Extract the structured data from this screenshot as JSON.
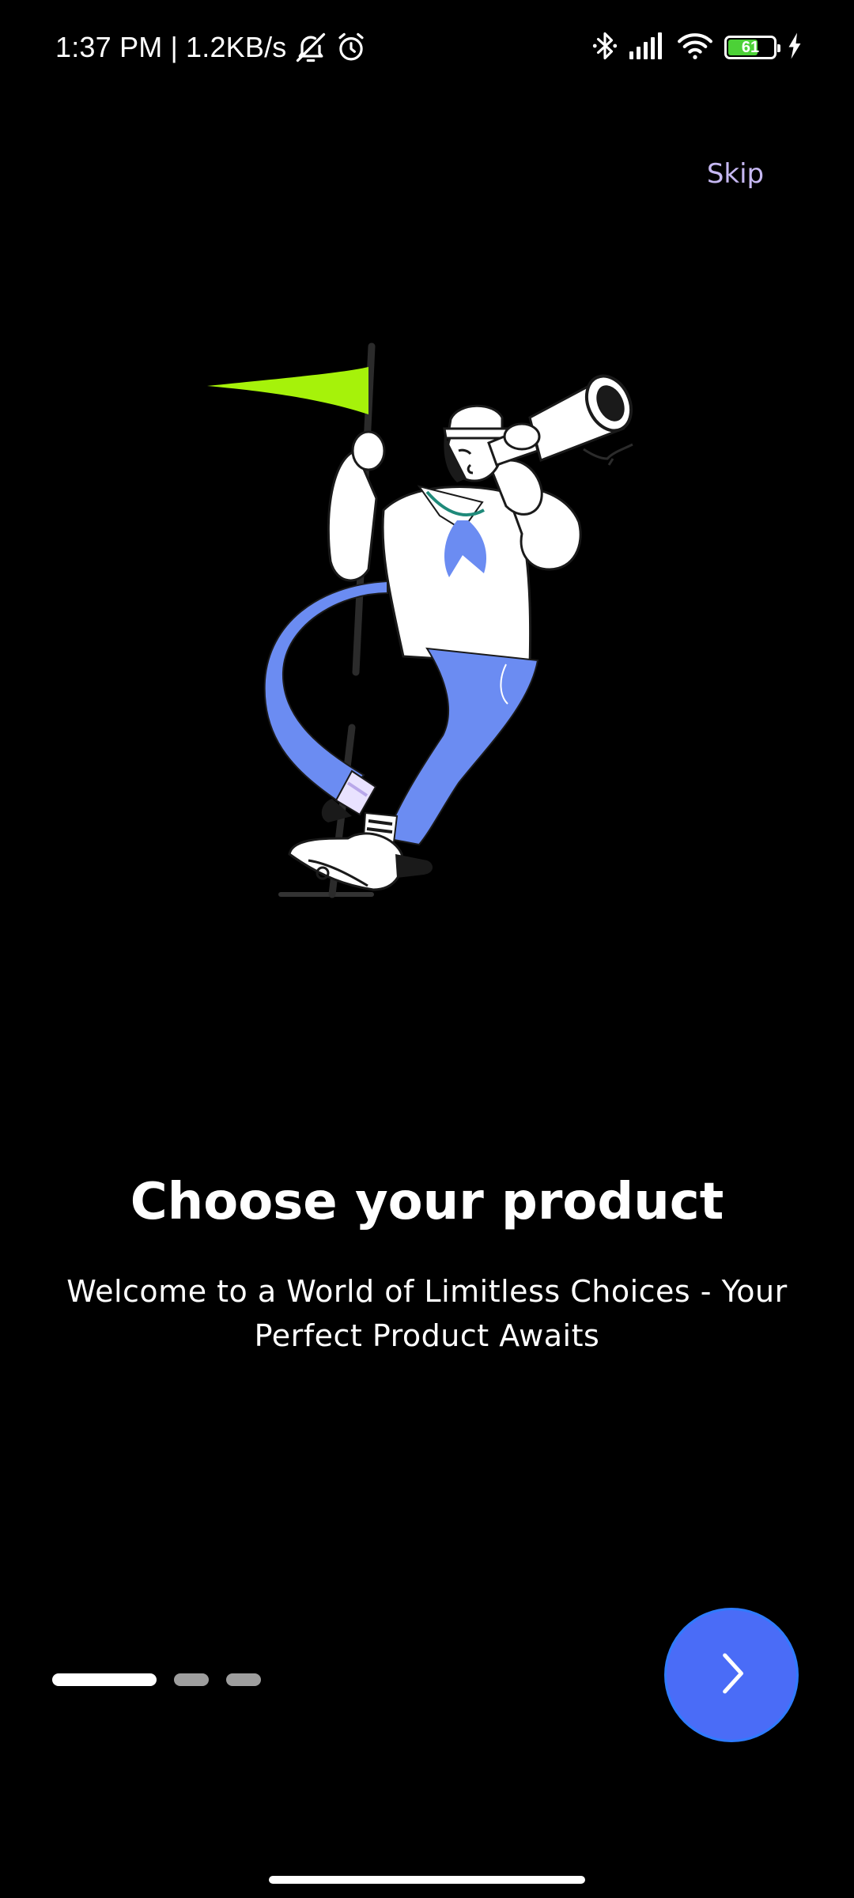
{
  "status_bar": {
    "time": "1:37 PM",
    "separator": "|",
    "network_speed": "1.2KB/s",
    "left_icons": [
      "bell-muted-icon",
      "alarm-icon"
    ],
    "right_icons": [
      "bluetooth-icon",
      "signal-icon",
      "wifi-icon",
      "battery-icon",
      "charging-icon"
    ],
    "battery_level": "61",
    "battery_color": "#4cd137"
  },
  "skip": {
    "label": "Skip",
    "color": "#c6b8f2"
  },
  "illustration": {
    "icon": "sailor-with-telescope-illustration",
    "flag_color": "#a6f20a",
    "accent_color": "#6b8cf2"
  },
  "onboarding": {
    "title": "Choose your product",
    "subtitle": "Welcome to a World of Limitless Choices - Your Perfect Product Awaits"
  },
  "pager": {
    "total_pages": 3,
    "current_page": 1
  },
  "next_button": {
    "icon": "chevron-right-icon",
    "color": "#4a6cf7"
  }
}
